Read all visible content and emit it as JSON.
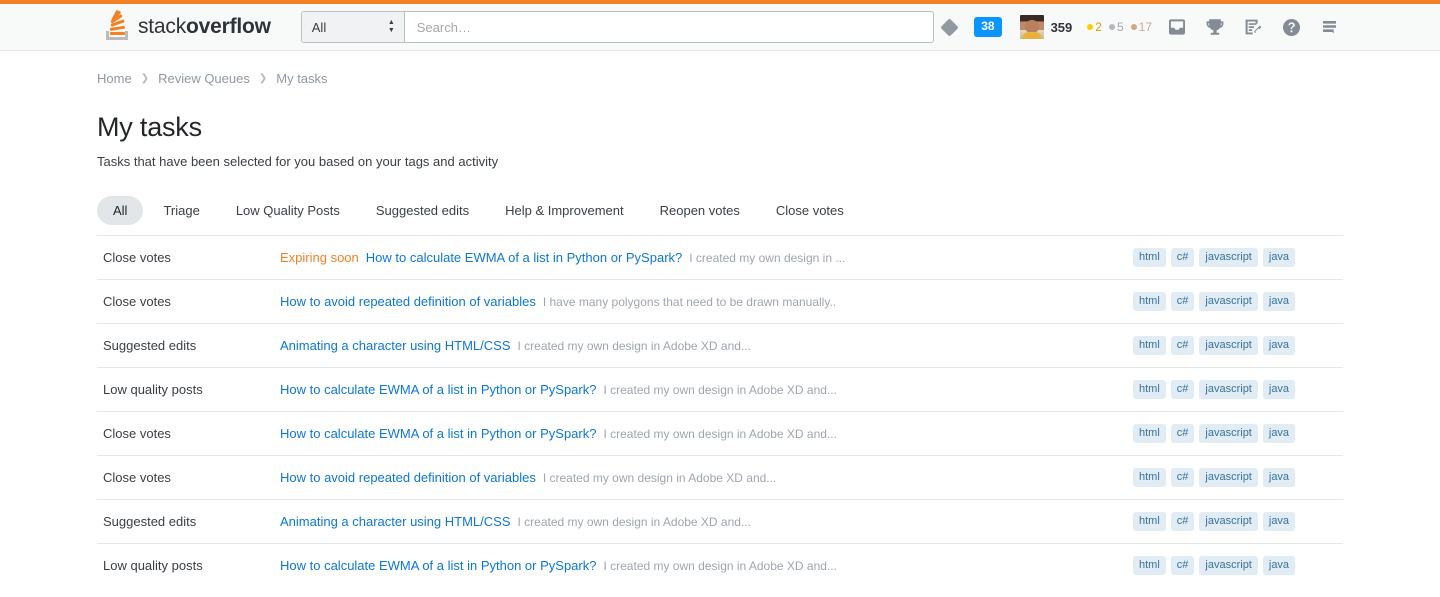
{
  "header": {
    "logo": {
      "light": "stack",
      "bold": "overflow",
      "icon": "stackoverflow-logo-icon"
    },
    "search": {
      "scope_value": "All",
      "placeholder": "Search…",
      "value": ""
    },
    "diamond_icon": "diamond-icon",
    "review_badge": "38",
    "user": {
      "avatar_icon": "user-avatar",
      "reputation": "359",
      "gold": "2",
      "silver": "5",
      "bronze": "17"
    },
    "icons": [
      {
        "name": "inbox-icon",
        "label": "Inbox"
      },
      {
        "name": "trophy-icon",
        "label": "Achievements"
      },
      {
        "name": "review-icon",
        "label": "Review"
      },
      {
        "name": "help-icon",
        "label": "Help"
      },
      {
        "name": "hamburger-icon",
        "label": "Site switcher"
      }
    ]
  },
  "breadcrumb": [
    {
      "label": "Home",
      "current": false
    },
    {
      "label": "Review Queues",
      "current": false
    },
    {
      "label": "My tasks",
      "current": true
    }
  ],
  "page": {
    "title": "My tasks",
    "subtitle": "Tasks that have been selected for you based on your tags and activity"
  },
  "tabs": [
    {
      "label": "All",
      "active": true
    },
    {
      "label": "Triage",
      "active": false
    },
    {
      "label": "Low Quality Posts",
      "active": false
    },
    {
      "label": "Suggested edits",
      "active": false
    },
    {
      "label": "Help & Improvement",
      "active": false
    },
    {
      "label": "Reopen votes",
      "active": false
    },
    {
      "label": "Close votes",
      "active": false
    }
  ],
  "tasks": [
    {
      "queue": "Close votes",
      "expiring": "Expiring soon",
      "title": "How to calculate EWMA of a list in Python or PySpark?",
      "excerpt": "I created my own design in ...",
      "tags": [
        "html",
        "c#",
        "javascript",
        "java"
      ]
    },
    {
      "queue": "Close votes",
      "expiring": "",
      "title": "How to avoid repeated definition of variables",
      "excerpt": "I have many polygons that need to be drawn manually..",
      "tags": [
        "html",
        "c#",
        "javascript",
        "java"
      ]
    },
    {
      "queue": "Suggested edits",
      "expiring": "",
      "title": "Animating a character using HTML/CSS",
      "excerpt": "I created my own design in Adobe XD and...",
      "tags": [
        "html",
        "c#",
        "javascript",
        "java"
      ]
    },
    {
      "queue": "Low quality posts",
      "expiring": "",
      "title": "How to calculate EWMA of a list in Python or PySpark?",
      "excerpt": "I created my own design in Adobe XD and...",
      "tags": [
        "html",
        "c#",
        "javascript",
        "java"
      ]
    },
    {
      "queue": "Close votes",
      "expiring": "",
      "title": "How to calculate EWMA of a list in Python or PySpark?",
      "excerpt": "I created my own design in Adobe XD and...",
      "tags": [
        "html",
        "c#",
        "javascript",
        "java"
      ]
    },
    {
      "queue": "Close votes",
      "expiring": "",
      "title": "How to avoid repeated definition of variables",
      "excerpt": "I created my own design in Adobe XD and...",
      "tags": [
        "html",
        "c#",
        "javascript",
        "java"
      ]
    },
    {
      "queue": "Suggested edits",
      "expiring": "",
      "title": "Animating a character using HTML/CSS",
      "excerpt": "I created my own design in Adobe XD and...",
      "tags": [
        "html",
        "c#",
        "javascript",
        "java"
      ]
    },
    {
      "queue": "Low quality posts",
      "expiring": "",
      "title": "How to calculate EWMA of a list in Python or PySpark?",
      "excerpt": "I created my own design in Adobe XD and...",
      "tags": [
        "html",
        "c#",
        "javascript",
        "java"
      ]
    }
  ],
  "colors": {
    "accent_orange": "#f48024",
    "link_blue": "#0c77d8",
    "badge_blue": "#0a95ff",
    "tag_bg": "#e1ecf4",
    "tag_fg": "#39739d"
  }
}
